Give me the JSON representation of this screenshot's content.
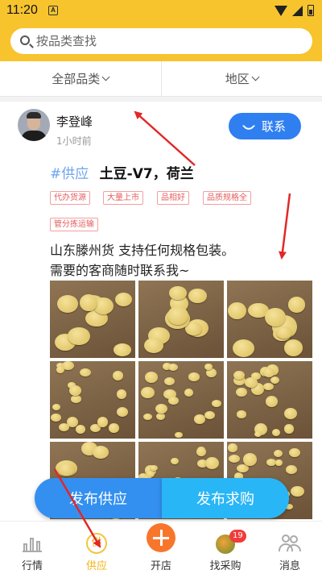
{
  "status_bar": {
    "time": "11:20",
    "notification_badge": "A"
  },
  "search": {
    "placeholder": "按品类查找"
  },
  "filters": {
    "category_label": "全部品类",
    "region_label": "地区"
  },
  "post": {
    "user_name": "李登峰",
    "time_ago": "1小时前",
    "contact_label": "联系",
    "type_tag": "#供应",
    "product_title": "土豆-V7，荷兰",
    "chips": [
      "代办货源",
      "大量上市",
      "品相好",
      "品质规格全",
      "管分拣运输"
    ],
    "description_line1": "山东滕州货 支持任何规格包装。",
    "description_line2": "需要的客商随时联系我~",
    "photo_count": 9
  },
  "actions": {
    "publish_supply": "发布供应",
    "publish_purchase": "发布求购"
  },
  "bottom_nav": {
    "items": [
      {
        "label": "行情",
        "icon": "bar-chart-icon"
      },
      {
        "label": "供应",
        "icon": "supply-badge-icon",
        "active": true
      },
      {
        "label": "开店",
        "icon": "plus-circle-icon"
      },
      {
        "label": "找采购",
        "icon": "purchase-avatar-icon",
        "badge": "19"
      },
      {
        "label": "消息",
        "icon": "people-icon"
      }
    ]
  },
  "colors": {
    "header_yellow": "#f7c42e",
    "contact_blue": "#2f7ff1",
    "supply_button_blue": "#3390f0",
    "purchase_button_cyan": "#29b6f6",
    "tag_blue": "#6ea4ef",
    "chip_red": "#e55d5d",
    "shop_orange": "#f8762c",
    "active_nav_gold": "#f2b417",
    "badge_red": "#f23b3b",
    "annotation_red": "#e32727"
  }
}
